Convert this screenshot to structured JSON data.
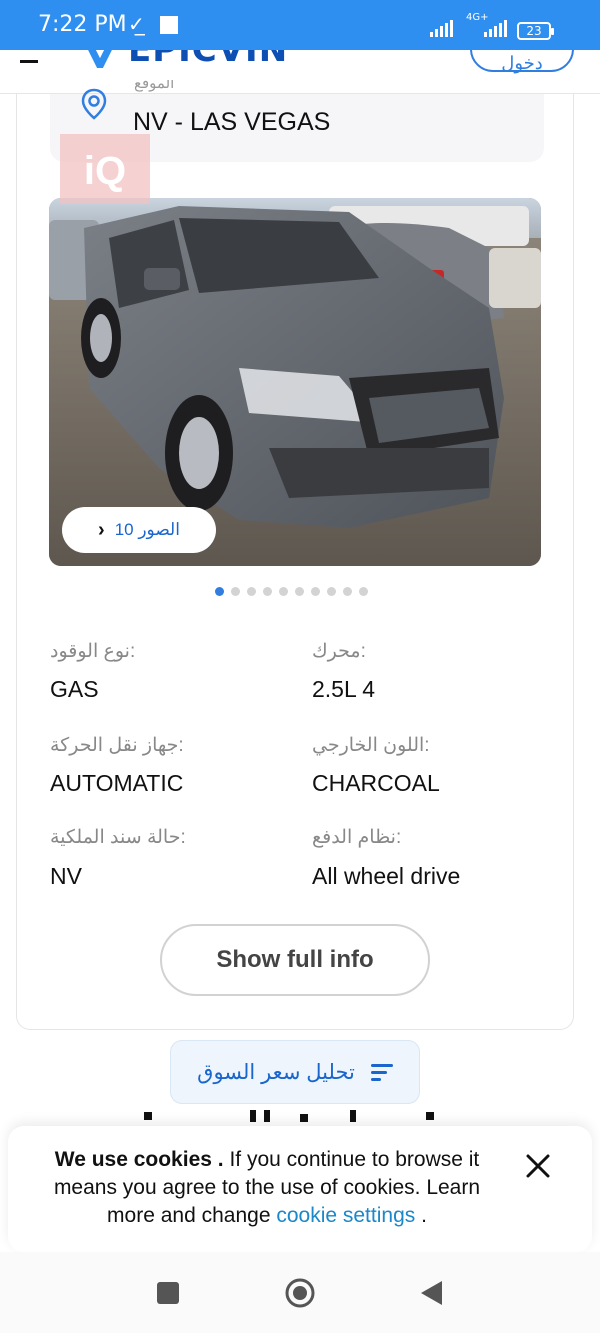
{
  "status_bar": {
    "time": "7:22 PM",
    "network": "4G+",
    "battery": "23"
  },
  "header": {
    "logo_text": "EPICVIN",
    "login_label": "دخول"
  },
  "location": {
    "label": "الموقع",
    "value": "NV - LAS VEGAS"
  },
  "photos": {
    "count_label": "10 الصور",
    "total_dots": 10,
    "active_dot": 0,
    "watermark": "iQ"
  },
  "specs": [
    {
      "label": ":نوع الوقود",
      "value": "GAS"
    },
    {
      "label": ":محرك",
      "value": "2.5L 4"
    },
    {
      "label": ":جهاز نقل الحركة",
      "value": "AUTOMATIC"
    },
    {
      "label": ":اللون الخارجي",
      "value": "CHARCOAL"
    },
    {
      "label": ":حالة سند الملكية",
      "value": "NV"
    },
    {
      "label": ":نظام الدفع",
      "value": "All wheel drive"
    }
  ],
  "actions": {
    "show_full_info": "Show full info",
    "market_analysis": "تحليل سعر السوق"
  },
  "cookie": {
    "title": "We use cookies .",
    "body": " If you continue to browse it means you agree to the use of cookies. Learn more and change ",
    "link": "cookie settings",
    "end": " ."
  },
  "colors": {
    "status_bar": "#2f8ff0",
    "accent": "#2f7ee0",
    "link": "#1a88c9"
  }
}
